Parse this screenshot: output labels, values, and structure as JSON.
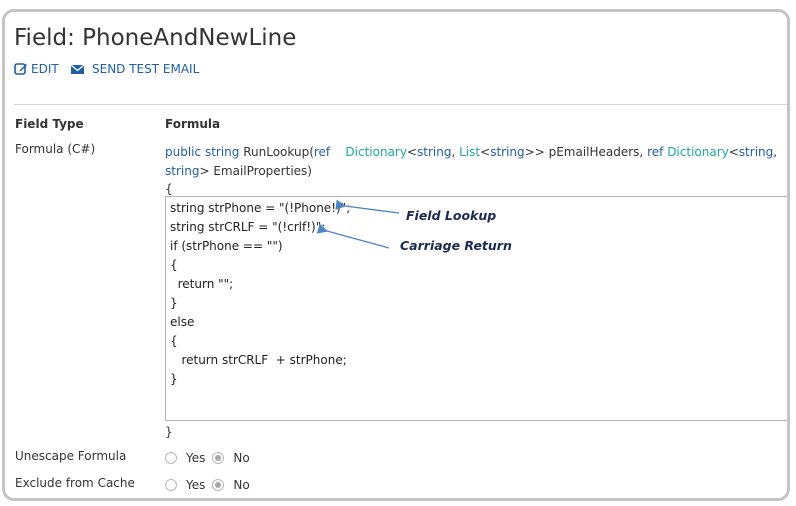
{
  "page": {
    "title": "Field: PhoneAndNewLine",
    "actions": [
      {
        "label": "EDIT",
        "icon": "edit-icon"
      },
      {
        "label": "SEND TEST EMAIL",
        "icon": "envelope-icon"
      }
    ]
  },
  "table": {
    "header_label": "Field Type",
    "header_value": "Formula",
    "formula_label": "Formula (C#)",
    "signature": {
      "kw_public": "public",
      "kw_string": "string",
      "method": "RunLookup(",
      "kw_ref1": "ref",
      "type_dict1": "Dictionary",
      "lt1": "<",
      "kw_string2": "string",
      "comma1": ",",
      "type_list": "List",
      "lt2": "<",
      "kw_string3": "string",
      "gt1": ">>",
      "param1": "pEmailHeaders,",
      "kw_ref2": "ref",
      "type_dict2": "Dictionary",
      "lt3": "<",
      "kw_string4": "string",
      "comma2": ",",
      "kw_string5": "string",
      "gt2": ">",
      "param2": "EmailProperties)"
    },
    "open_brace": "{",
    "close_brace": "}",
    "code_lines": [
      "string strPhone = \"(!Phone!)\";",
      "string strCRLF = \"(!crlf!)\";",
      "if (strPhone == \"\")",
      "{",
      "  return \"\";",
      "}",
      "else",
      "{",
      "   return strCRLF  + strPhone;",
      "}"
    ],
    "annotations": {
      "field_lookup": "Field Lookup",
      "carriage_return": "Carriage Return"
    },
    "unescape_label": "Unescape Formula",
    "exclude_label": "Exclude from Cache",
    "option_yes": "Yes",
    "option_no": "No",
    "unescape_selected": "No",
    "exclude_selected": "No"
  },
  "colors": {
    "accent": "#1f5fa8",
    "type_teal": "#1fa8a8",
    "annotation": "#1a2a55",
    "arrow": "#4a86c8"
  }
}
